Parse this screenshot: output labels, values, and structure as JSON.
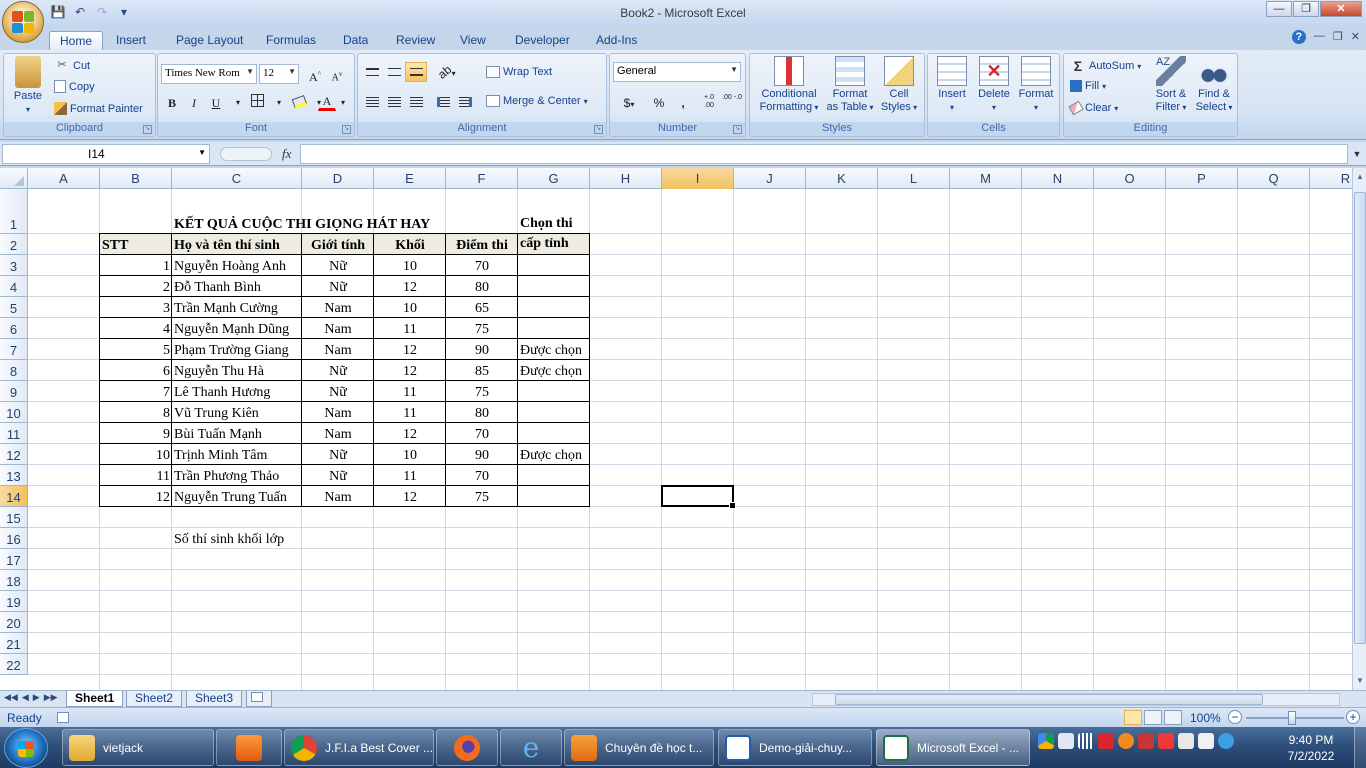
{
  "window": {
    "doc_name": "Book2",
    "separator": "-",
    "app_name": "Microsoft Excel"
  },
  "ribbon_tabs": [
    "Home",
    "Insert",
    "Page Layout",
    "Formulas",
    "Data",
    "Review",
    "View",
    "Developer",
    "Add-Ins"
  ],
  "clipboard": {
    "paste": "Paste",
    "cut": "Cut",
    "copy": "Copy",
    "format_painter": "Format Painter",
    "label": "Clipboard"
  },
  "font": {
    "name": "Times New Rom",
    "size": "12",
    "bold": "B",
    "italic": "I",
    "underline": "U",
    "grow": "A",
    "shrink": "A",
    "color_letter": "A",
    "label": "Font"
  },
  "alignment": {
    "wrap_text": "Wrap Text",
    "merge_center": "Merge & Center",
    "label": "Alignment"
  },
  "number": {
    "format": "General",
    "currency": "$",
    "percent": "%",
    "comma": ",",
    "inc_decimal": "+.0 .00",
    "dec_decimal": ".00 -.0",
    "label": "Number"
  },
  "styles": {
    "conditional": [
      "Conditional",
      "Formatting"
    ],
    "format_table": [
      "Format",
      "as Table"
    ],
    "cell_styles": [
      "Cell",
      "Styles"
    ],
    "label": "Styles"
  },
  "cells": {
    "insert": "Insert",
    "delete": "Delete",
    "format": "Format",
    "label": "Cells"
  },
  "editing": {
    "autosum": "AutoSum",
    "fill": "Fill",
    "clear": "Clear",
    "sort_filter": [
      "Sort &",
      "Filter"
    ],
    "find_select": [
      "Find &",
      "Select"
    ],
    "label": "Editing"
  },
  "formula_bar": {
    "name_box": "I14",
    "fx": "fx",
    "value": ""
  },
  "columns": [
    "A",
    "B",
    "C",
    "D",
    "E",
    "F",
    "G",
    "H",
    "I",
    "J",
    "K",
    "L",
    "M",
    "N",
    "O",
    "P",
    "Q",
    "R"
  ],
  "rows": [
    "1",
    "2",
    "3",
    "4",
    "5",
    "6",
    "7",
    "8",
    "9",
    "10",
    "11",
    "12",
    "13",
    "14",
    "15",
    "16",
    "17",
    "18",
    "19",
    "20",
    "21",
    "22"
  ],
  "sheet": {
    "title": "KẾT QUẢ CUỘC THI GIỌNG HÁT HAY",
    "headers": {
      "stt": "STT",
      "name": "Họ và tên thí sinh",
      "gender": "Giới tính",
      "grade": "Khối",
      "score": "Điểm thi",
      "selected": "Chọn thi cấp tỉnh"
    },
    "records": [
      {
        "stt": "1",
        "name": "Nguyễn Hoàng Anh",
        "gender": "Nữ",
        "grade": "10",
        "score": "70",
        "selected": ""
      },
      {
        "stt": "2",
        "name": "Đỗ Thanh Bình",
        "gender": "Nữ",
        "grade": "12",
        "score": "80",
        "selected": ""
      },
      {
        "stt": "3",
        "name": "Trần Mạnh Cường",
        "gender": "Nam",
        "grade": "10",
        "score": "65",
        "selected": ""
      },
      {
        "stt": "4",
        "name": "Nguyễn Mạnh Dũng",
        "gender": "Nam",
        "grade": "11",
        "score": "75",
        "selected": ""
      },
      {
        "stt": "5",
        "name": "Phạm Trường Giang",
        "gender": "Nam",
        "grade": "12",
        "score": "90",
        "selected": "Được chọn"
      },
      {
        "stt": "6",
        "name": "Nguyễn Thu Hà",
        "gender": "Nữ",
        "grade": "12",
        "score": "85",
        "selected": "Được chọn"
      },
      {
        "stt": "7",
        "name": "Lê Thanh Hương",
        "gender": "Nữ",
        "grade": "11",
        "score": "75",
        "selected": ""
      },
      {
        "stt": "8",
        "name": "Vũ Trung Kiên",
        "gender": "Nam",
        "grade": "11",
        "score": "80",
        "selected": ""
      },
      {
        "stt": "9",
        "name": "Bùi Tuấn Mạnh",
        "gender": "Nam",
        "grade": "12",
        "score": "70",
        "selected": ""
      },
      {
        "stt": "10",
        "name": "Trịnh Minh Tâm",
        "gender": "Nữ",
        "grade": "10",
        "score": "90",
        "selected": "Được chọn"
      },
      {
        "stt": "11",
        "name": "Trần Phương Thảo",
        "gender": "Nữ",
        "grade": "11",
        "score": "70",
        "selected": ""
      },
      {
        "stt": "12",
        "name": "Nguyễn Trung Tuấn",
        "gender": "Nam",
        "grade": "12",
        "score": "75",
        "selected": ""
      }
    ],
    "note": "Số thí sinh khối lớp"
  },
  "sheet_tabs": [
    "Sheet1",
    "Sheet2",
    "Sheet3"
  ],
  "status": {
    "mode": "Ready",
    "zoom": "100%"
  },
  "taskbar": {
    "items": [
      "vietjack",
      "",
      "J.F.I.a Best Cover ...",
      "",
      "",
      "Chuyên đề học t...",
      "Demo-giải-chuy...",
      "Microsoft Excel - ..."
    ],
    "time": "9:40 PM",
    "date": "7/2/2022"
  },
  "colors": {
    "ribbon_text": "#15428b",
    "selected_header": "#f1c15f",
    "gridline": "#d0d7e5"
  }
}
